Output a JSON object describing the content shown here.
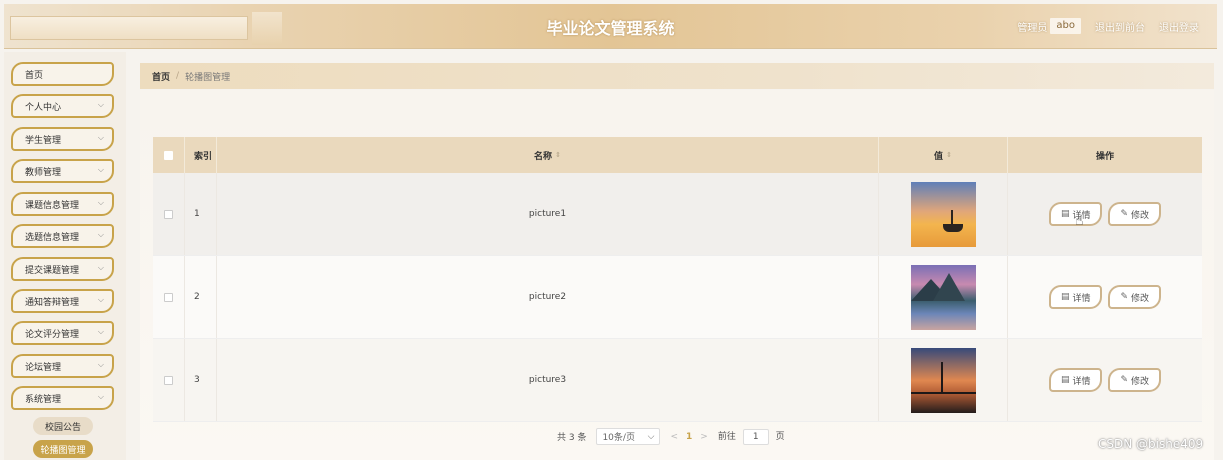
{
  "header": {
    "title": "毕业论文管理系统",
    "user_prefix": "管理员",
    "user_name": "abo",
    "back_to_front": "退出到前台",
    "logout": "退出登录"
  },
  "sidebar": {
    "items": [
      {
        "label": "首页",
        "has_children": false
      },
      {
        "label": "个人中心",
        "has_children": true
      },
      {
        "label": "学生管理",
        "has_children": true
      },
      {
        "label": "教师管理",
        "has_children": true
      },
      {
        "label": "课题信息管理",
        "has_children": true
      },
      {
        "label": "选题信息管理",
        "has_children": true
      },
      {
        "label": "提交课题管理",
        "has_children": true
      },
      {
        "label": "通知答辩管理",
        "has_children": true
      },
      {
        "label": "论文评分管理",
        "has_children": true
      },
      {
        "label": "论坛管理",
        "has_children": true
      },
      {
        "label": "系统管理",
        "has_children": true
      }
    ],
    "sub_items": [
      {
        "label": "校园公告",
        "active": false
      },
      {
        "label": "轮播图管理",
        "active": true
      }
    ]
  },
  "breadcrumb": {
    "home": "首页",
    "separator": "/",
    "current": "轮播图管理"
  },
  "table": {
    "columns": {
      "index": "索引",
      "name": "名称",
      "value": "值",
      "actions": "操作"
    },
    "rows": [
      {
        "index": "1",
        "name": "picture1",
        "image": "sunset-boat"
      },
      {
        "index": "2",
        "name": "picture2",
        "image": "mountain-lake"
      },
      {
        "index": "3",
        "name": "picture3",
        "image": "bridge-sunset"
      }
    ],
    "detail_label": "详情",
    "edit_label": "修改"
  },
  "pagination": {
    "total": "共 3 条",
    "page_size": "10条/页",
    "prev": "<",
    "current_page": "1",
    "next": ">",
    "goto_prefix": "前往",
    "goto_value": "1",
    "goto_suffix": "页"
  },
  "watermark": "CSDN @bishe409",
  "colors": {
    "accent": "#c8a34a",
    "header_bg": "#e3c595",
    "table_header_bg": "#ead9bd"
  }
}
